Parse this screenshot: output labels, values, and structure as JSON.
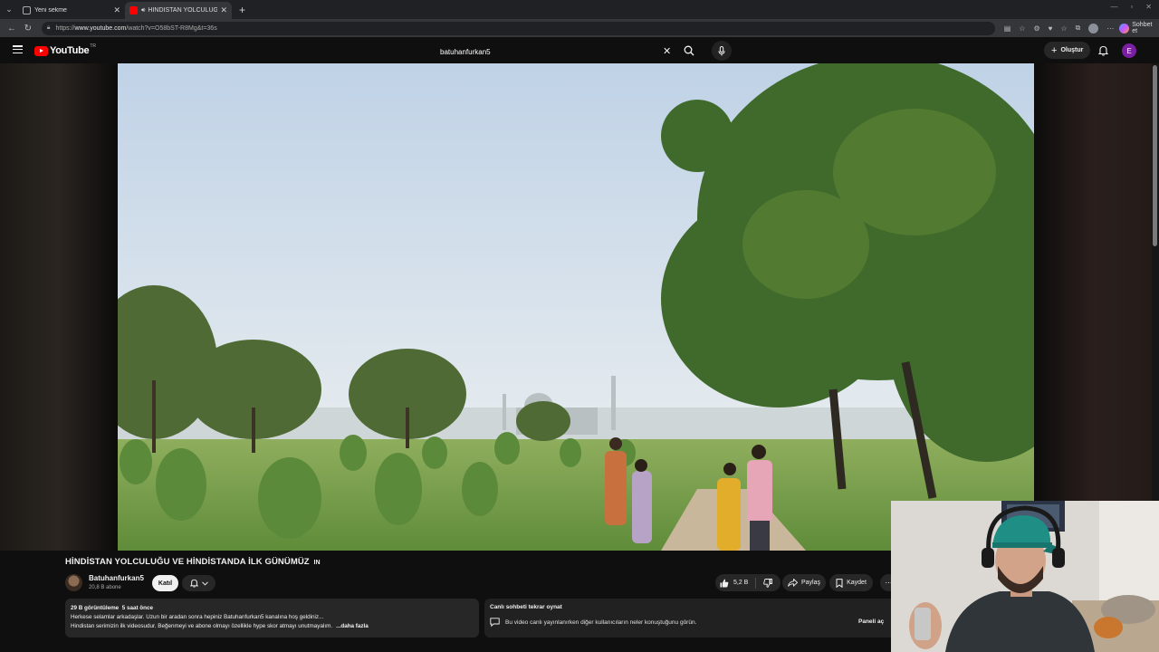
{
  "browser": {
    "tabs": [
      {
        "label": "Yeni sekme",
        "active": false
      },
      {
        "label": "HİNDİSTAN YOLCULUĞU VE Hİ",
        "active": true
      }
    ],
    "new_tab": "+",
    "url_prefix": "https://",
    "url_host": "www.youtube.com",
    "url_path": "/watch?v=O58bST-R8Mg&t=36s",
    "copilot_label": "Sohbet et"
  },
  "header": {
    "logo_text": "YouTube",
    "region": "TR",
    "search_value": "batuhanfurkan5",
    "create_label": "Oluştur",
    "avatar_letter": "E"
  },
  "video": {
    "title": "HİNDİSTAN YOLCULUĞU VE HİNDİSTANDA İLK GÜNÜMÜZ",
    "title_suffix": "IN",
    "channel_name": "Batuhanfurkan5",
    "subscribers": "20,8 B abone",
    "join_label": "Katıl",
    "likes": "5,2 B",
    "share_label": "Paylaş",
    "save_label": "Kaydet",
    "more_label": "⋯"
  },
  "description": {
    "views": "29 B görüntüleme",
    "age": "5 saat önce",
    "line1": "Herkese selamlar arkadaşlar. Uzun bir aradan sonra hepiniz Batuhanfurkan5 kanalına hoş geldiniz...",
    "line2": "Hindistan serimizin ilk videosudur. Beğenmeyi ve abone olmayı özellikle hype skor atmayı unutmayalım.",
    "more_label": "...daha fazla"
  },
  "chat_replay": {
    "title": "Canlı sohbeti tekrar oynat",
    "text": "Bu video canlı yayınlanırken diğer kullanıcıların neler konuştuğunu görün.",
    "open_label": "Paneli aç"
  },
  "colors": {
    "accent_red": "#ff0000",
    "bg": "#0f0f0f",
    "chip": "#272727",
    "avatar": "#7b1fa2"
  }
}
